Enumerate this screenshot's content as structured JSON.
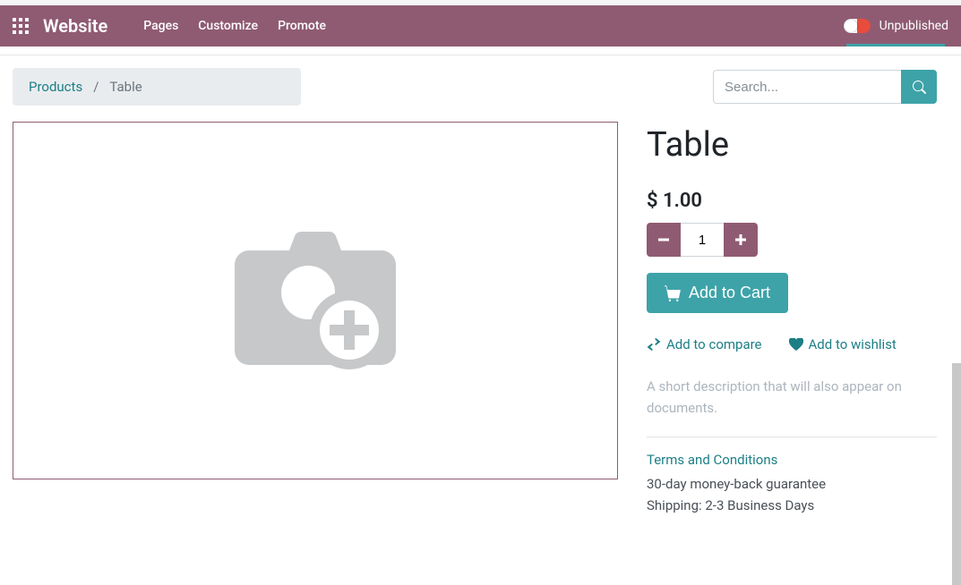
{
  "navbar": {
    "brand": "Website",
    "menu": [
      "Pages",
      "Customize",
      "Promote"
    ],
    "publish_status": "Unpublished"
  },
  "breadcrumb": {
    "root": "Products",
    "current": "Table"
  },
  "search": {
    "placeholder": "Search..."
  },
  "product": {
    "title": "Table",
    "price": "$ 1.00",
    "quantity": "1",
    "add_to_cart": "Add to Cart",
    "compare_label": "Add to compare",
    "wishlist_label": "Add to wishlist",
    "short_description": "A short description that will also appear on documents.",
    "terms_link": "Terms and Conditions",
    "guarantee": "30-day money-back guarantee",
    "shipping": "Shipping: 2-3 Business Days"
  }
}
